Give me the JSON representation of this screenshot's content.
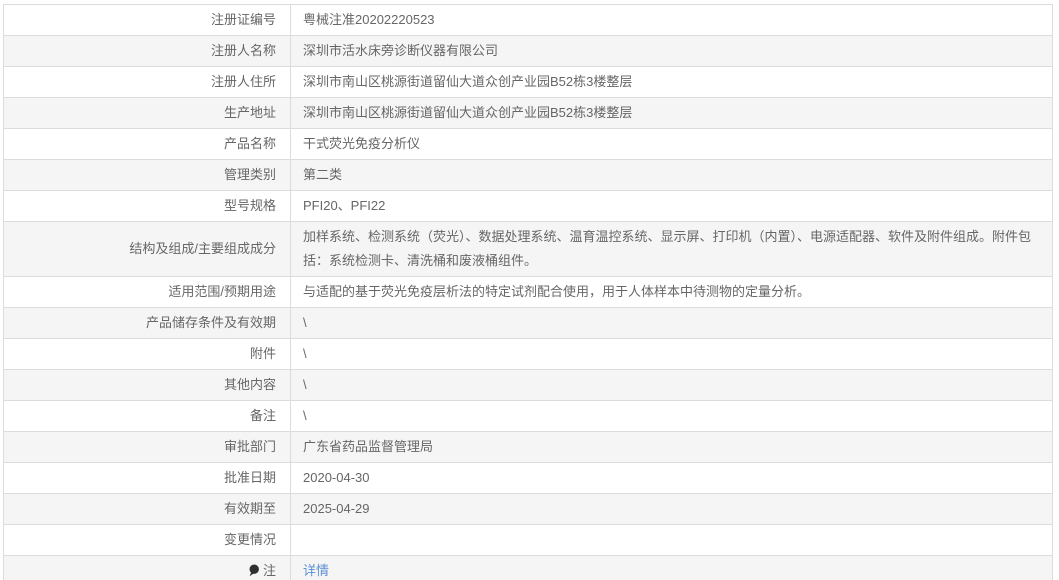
{
  "colors": {
    "text": "#666666",
    "link": "#5b8fd6",
    "stripe": "#f5f5f5",
    "border": "#dcdcdc",
    "icon": "#2f2f2f"
  },
  "table": {
    "name": "medical-device-registration-info",
    "rows": [
      {
        "label": "注册证编号",
        "value": "粤械注准20202220523"
      },
      {
        "label": "注册人名称",
        "value": "深圳市活水床旁诊断仪器有限公司"
      },
      {
        "label": "注册人住所",
        "value": "深圳市南山区桃源街道留仙大道众创产业园B52栋3楼整层"
      },
      {
        "label": "生产地址",
        "value": "深圳市南山区桃源街道留仙大道众创产业园B52栋3楼整层"
      },
      {
        "label": "产品名称",
        "value": "干式荧光免疫分析仪"
      },
      {
        "label": "管理类别",
        "value": "第二类"
      },
      {
        "label": "型号规格",
        "value": "PFI20、PFI22"
      },
      {
        "label": "结构及组成/主要组成成分",
        "value": "加样系统、检测系统（荧光）、数据处理系统、温育温控系统、显示屏、打印机（内置）、电源适配器、软件及附件组成。附件包括：系统检测卡、清洗桶和废液桶组件。"
      },
      {
        "label": "适用范围/预期用途",
        "value": "与适配的基于荧光免疫层析法的特定试剂配合使用，用于人体样本中待测物的定量分析。"
      },
      {
        "label": "产品储存条件及有效期",
        "value": "\\"
      },
      {
        "label": "附件",
        "value": "\\"
      },
      {
        "label": "其他内容",
        "value": "\\"
      },
      {
        "label": "备注",
        "value": "\\"
      },
      {
        "label": "审批部门",
        "value": "广东省药品监督管理局"
      },
      {
        "label": "批准日期",
        "value": "2020-04-30"
      },
      {
        "label": "有效期至",
        "value": "2025-04-29"
      },
      {
        "label": "变更情况",
        "value": ""
      },
      {
        "label": "注",
        "value": "详情",
        "icon": "note-icon",
        "link": true
      }
    ]
  }
}
